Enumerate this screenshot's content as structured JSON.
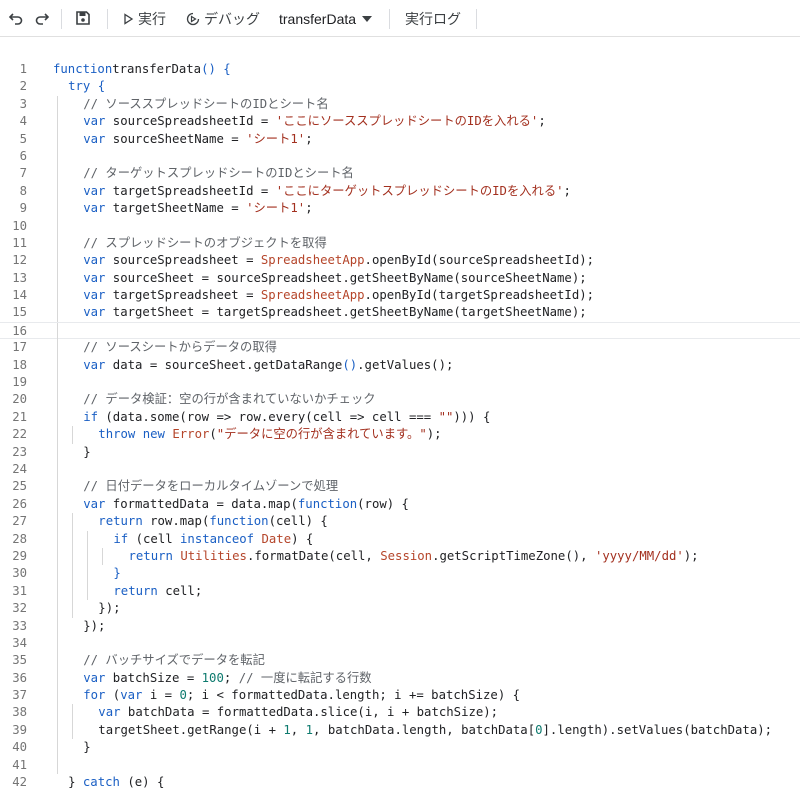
{
  "toolbar": {
    "run_label": "実行",
    "debug_label": "デバッグ",
    "function_name": "transferData",
    "log_label": "実行ログ"
  },
  "editor": {
    "current_line": 16,
    "lines": [
      {
        "n": "1",
        "indent": 0,
        "tokens": [
          [
            "kw",
            "function"
          ],
          [
            "",
            "transferData"
          ],
          [
            "bb",
            "()"
          ],
          [
            "",
            " "
          ],
          [
            "bb",
            "{"
          ]
        ]
      },
      {
        "n": "2",
        "indent": 1,
        "tokens": [
          [
            "kw",
            "try"
          ],
          [
            "",
            " "
          ],
          [
            "bb",
            "{"
          ]
        ]
      },
      {
        "n": "3",
        "indent": 2,
        "tokens": [
          [
            "cm",
            "// ソーススプレッドシートのIDとシート名"
          ]
        ]
      },
      {
        "n": "4",
        "indent": 2,
        "tokens": [
          [
            "kw",
            "var"
          ],
          [
            "",
            " sourceSpreadsheetId = "
          ],
          [
            "str",
            "'ここにソーススプレッドシートのIDを入れる'"
          ],
          [
            "",
            ";"
          ]
        ]
      },
      {
        "n": "5",
        "indent": 2,
        "tokens": [
          [
            "kw",
            "var"
          ],
          [
            "",
            " sourceSheetName = "
          ],
          [
            "str",
            "'シート1'"
          ],
          [
            "",
            ";"
          ]
        ]
      },
      {
        "n": "6",
        "indent": 2,
        "tokens": []
      },
      {
        "n": "7",
        "indent": 2,
        "tokens": [
          [
            "cm",
            "// ターゲットスプレッドシートのIDとシート名"
          ]
        ]
      },
      {
        "n": "8",
        "indent": 2,
        "tokens": [
          [
            "kw",
            "var"
          ],
          [
            "",
            " targetSpreadsheetId = "
          ],
          [
            "str",
            "'ここにターゲットスプレッドシートのIDを入れる'"
          ],
          [
            "",
            ";"
          ]
        ]
      },
      {
        "n": "9",
        "indent": 2,
        "tokens": [
          [
            "kw",
            "var"
          ],
          [
            "",
            " targetSheetName = "
          ],
          [
            "str",
            "'シート1'"
          ],
          [
            "",
            ";"
          ]
        ]
      },
      {
        "n": "10",
        "indent": 2,
        "tokens": []
      },
      {
        "n": "11",
        "indent": 2,
        "tokens": [
          [
            "cm",
            "// スプレッドシートのオブジェクトを取得"
          ]
        ]
      },
      {
        "n": "12",
        "indent": 2,
        "tokens": [
          [
            "kw",
            "var"
          ],
          [
            "",
            " sourceSpreadsheet = "
          ],
          [
            "cls",
            "SpreadsheetApp"
          ],
          [
            "",
            ".openById(sourceSpreadsheetId);"
          ]
        ]
      },
      {
        "n": "13",
        "indent": 2,
        "tokens": [
          [
            "kw",
            "var"
          ],
          [
            "",
            " sourceSheet = sourceSpreadsheet.getSheetByName(sourceSheetName);"
          ]
        ]
      },
      {
        "n": "14",
        "indent": 2,
        "tokens": [
          [
            "kw",
            "var"
          ],
          [
            "",
            " targetSpreadsheet = "
          ],
          [
            "cls",
            "SpreadsheetApp"
          ],
          [
            "",
            ".openById(targetSpreadsheetId);"
          ]
        ]
      },
      {
        "n": "15",
        "indent": 2,
        "tokens": [
          [
            "kw",
            "var"
          ],
          [
            "",
            " targetSheet = targetSpreadsheet.getSheetByName(targetSheetName);"
          ]
        ]
      },
      {
        "n": "16",
        "indent": 2,
        "tokens": []
      },
      {
        "n": "17",
        "indent": 2,
        "tokens": [
          [
            "cm",
            "// ソースシートからデータの取得"
          ]
        ]
      },
      {
        "n": "18",
        "indent": 2,
        "tokens": [
          [
            "kw",
            "var"
          ],
          [
            "",
            " data = sourceSheet.getDataRange"
          ],
          [
            "bb",
            "()"
          ],
          [
            "",
            ".getValues();"
          ]
        ]
      },
      {
        "n": "19",
        "indent": 2,
        "tokens": []
      },
      {
        "n": "20",
        "indent": 2,
        "tokens": [
          [
            "cm",
            "// データ検証：空の行が含まれていないかチェック"
          ]
        ]
      },
      {
        "n": "21",
        "indent": 2,
        "tokens": [
          [
            "kw",
            "if"
          ],
          [
            "",
            " (data.some(row => row.every(cell => cell === "
          ],
          [
            "str",
            "\"\""
          ],
          [
            "",
            ")))"
          ],
          [
            "",
            " {"
          ]
        ]
      },
      {
        "n": "22",
        "indent": 3,
        "tokens": [
          [
            "kw",
            "throw"
          ],
          [
            "",
            " "
          ],
          [
            "kw",
            "new"
          ],
          [
            "",
            " "
          ],
          [
            "cls",
            "Error"
          ],
          [
            "",
            "("
          ],
          [
            "str",
            "\"データに空の行が含まれています。\""
          ],
          [
            "",
            ");"
          ]
        ]
      },
      {
        "n": "23",
        "indent": 2,
        "tokens": [
          [
            "",
            "}"
          ]
        ]
      },
      {
        "n": "24",
        "indent": 2,
        "tokens": []
      },
      {
        "n": "25",
        "indent": 2,
        "tokens": [
          [
            "cm",
            "// 日付データをローカルタイムゾーンで処理"
          ]
        ]
      },
      {
        "n": "26",
        "indent": 2,
        "tokens": [
          [
            "kw",
            "var"
          ],
          [
            "",
            " formattedData = data.map("
          ],
          [
            "kw",
            "function"
          ],
          [
            "",
            "(row) {"
          ]
        ]
      },
      {
        "n": "27",
        "indent": 3,
        "tokens": [
          [
            "kw",
            "return"
          ],
          [
            "",
            " row.map("
          ],
          [
            "kw",
            "function"
          ],
          [
            "",
            "(cell) {"
          ]
        ]
      },
      {
        "n": "28",
        "indent": 4,
        "tokens": [
          [
            "kw",
            "if"
          ],
          [
            "",
            " (cell "
          ],
          [
            "kw",
            "instanceof"
          ],
          [
            "",
            " "
          ],
          [
            "cls",
            "Date"
          ],
          [
            "",
            ") {"
          ]
        ]
      },
      {
        "n": "29",
        "indent": 5,
        "tokens": [
          [
            "kw",
            "return"
          ],
          [
            "",
            " "
          ],
          [
            "cls",
            "Utilities"
          ],
          [
            "",
            ".formatDate(cell, "
          ],
          [
            "cls",
            "Session"
          ],
          [
            "",
            ".getScriptTimeZone(), "
          ],
          [
            "str",
            "'yyyy/MM/dd'"
          ],
          [
            "",
            ");"
          ]
        ]
      },
      {
        "n": "30",
        "indent": 4,
        "tokens": [
          [
            "bb",
            "}"
          ]
        ]
      },
      {
        "n": "31",
        "indent": 4,
        "tokens": [
          [
            "kw",
            "return"
          ],
          [
            "",
            " cell;"
          ]
        ]
      },
      {
        "n": "32",
        "indent": 3,
        "tokens": [
          [
            "",
            "});"
          ]
        ]
      },
      {
        "n": "33",
        "indent": 2,
        "tokens": [
          [
            "",
            "});"
          ]
        ]
      },
      {
        "n": "34",
        "indent": 2,
        "tokens": []
      },
      {
        "n": "35",
        "indent": 2,
        "tokens": [
          [
            "cm",
            "// バッチサイズでデータを転記"
          ]
        ]
      },
      {
        "n": "36",
        "indent": 2,
        "tokens": [
          [
            "kw",
            "var"
          ],
          [
            "",
            " batchSize = "
          ],
          [
            "num",
            "100"
          ],
          [
            "",
            "; "
          ],
          [
            "cm",
            "// 一度に転記する行数"
          ]
        ]
      },
      {
        "n": "37",
        "indent": 2,
        "tokens": [
          [
            "kw",
            "for"
          ],
          [
            "",
            " ("
          ],
          [
            "kw",
            "var"
          ],
          [
            "",
            " i = "
          ],
          [
            "num",
            "0"
          ],
          [
            "",
            "; i < formattedData.length; i += batchSize) {"
          ]
        ]
      },
      {
        "n": "38",
        "indent": 3,
        "tokens": [
          [
            "kw",
            "var"
          ],
          [
            "",
            " batchData = formattedData.slice(i, i + batchSize);"
          ]
        ]
      },
      {
        "n": "39",
        "indent": 3,
        "tokens": [
          [
            "",
            "targetSheet.getRange(i + "
          ],
          [
            "num",
            "1"
          ],
          [
            "",
            ", "
          ],
          [
            "num",
            "1"
          ],
          [
            "",
            ", batchData.length, batchData["
          ],
          [
            "num",
            "0"
          ],
          [
            "",
            "].length).setValues(batchData);"
          ]
        ]
      },
      {
        "n": "40",
        "indent": 2,
        "tokens": [
          [
            "",
            "}"
          ]
        ]
      },
      {
        "n": "41",
        "indent": 2,
        "tokens": []
      },
      {
        "n": "42",
        "indent": 1,
        "tokens": [
          [
            "",
            "} "
          ],
          [
            "kw",
            "catch"
          ],
          [
            "",
            " (e) {"
          ]
        ]
      }
    ]
  }
}
